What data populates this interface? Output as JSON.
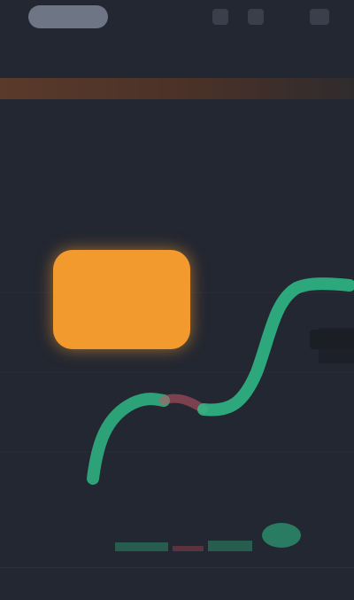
{
  "header": {
    "logo": "",
    "icons": [
      "search-icon",
      "bell-icon",
      "menu-icon"
    ]
  },
  "tabs": [
    {
      "label": "",
      "active": true
    },
    {
      "label": "",
      "active": false
    },
    {
      "label": "",
      "active": false
    },
    {
      "label": "",
      "active": false
    },
    {
      "label": "",
      "active": false
    }
  ],
  "announcement": {
    "text": ""
  },
  "ticker": {
    "price": "",
    "sub": "",
    "stats": [
      {
        "label": "",
        "value": ""
      },
      {
        "label": "",
        "value": ""
      },
      {
        "label": "",
        "value": ""
      },
      {
        "label": "",
        "value": ""
      }
    ]
  },
  "intervals": [
    {
      "label": "",
      "active": false
    },
    {
      "label": "",
      "active": false
    },
    {
      "label": "",
      "active": true
    },
    {
      "label": "",
      "active": false
    },
    {
      "label": "",
      "active": false
    },
    {
      "label": "",
      "active": false
    }
  ],
  "chart": {
    "highlight_card": "",
    "price_tag": "",
    "axis_labels": [
      "",
      "",
      "",
      ""
    ]
  },
  "bottom_nav": [
    "",
    "",
    "",
    ""
  ],
  "colors": {
    "background": "#232731",
    "up": "#2fc08a",
    "down": "#e25563",
    "accent": "#f39a2e",
    "announcement": "#5a3a2a"
  }
}
